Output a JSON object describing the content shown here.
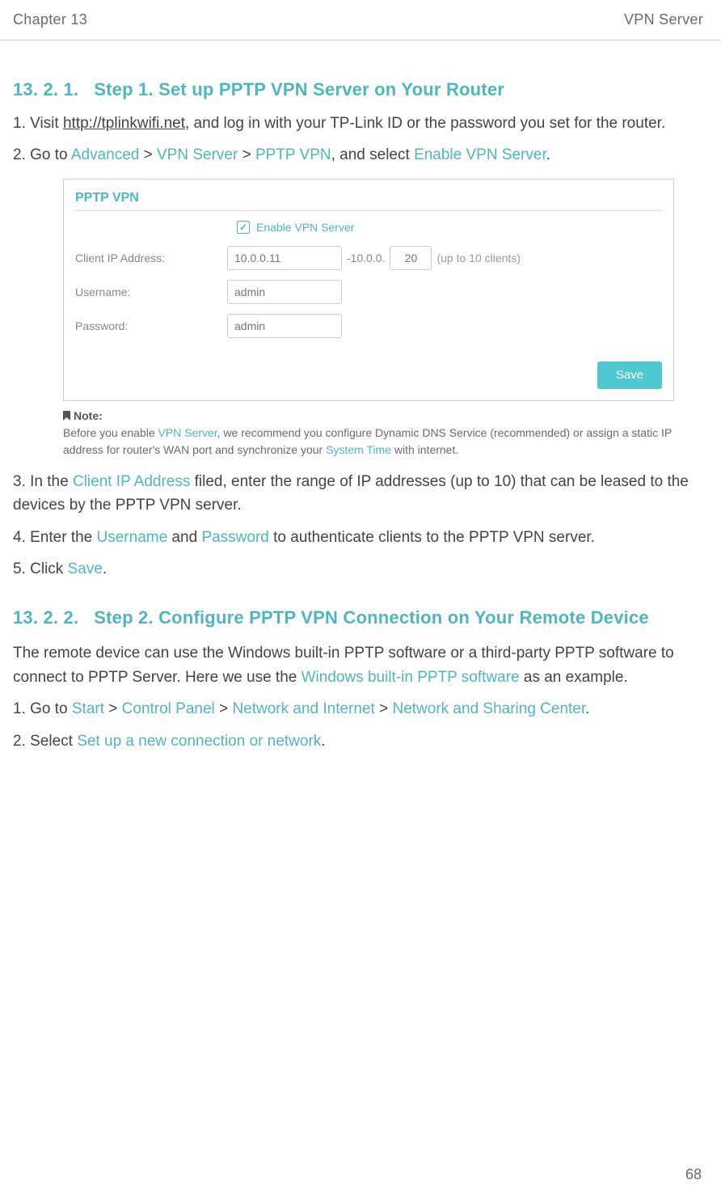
{
  "header": {
    "left": "Chapter 13",
    "right": "VPN Server"
  },
  "section1": {
    "number": "13. 2. 1.",
    "title": "Step 1. Set up PPTP VPN Server on Your Router"
  },
  "steps1": {
    "s1a": "1. Visit ",
    "s1link": "http://tplinkwifi.net",
    "s1b": ", and log in with your TP-Link ID or the password you set for the router.",
    "s2a": "2. Go to ",
    "s2t1": "Advanced",
    "s2t2": "VPN Server",
    "s2t3": "PPTP VPN",
    "s2b": ", and select ",
    "s2t4": "Enable VPN Server",
    "s2c": "."
  },
  "screenshot": {
    "title": "PPTP VPN",
    "enable_label": "Enable VPN Server",
    "row_client_label": "Client IP Address:",
    "client_ip_start": "10.0.0.11",
    "mid": "-10.0.0.",
    "client_ip_end": "20",
    "hint": "(up to 10 clients)",
    "row_user_label": "Username:",
    "username": "admin",
    "row_pass_label": "Password:",
    "password": "admin",
    "save": "Save"
  },
  "note": {
    "label": "Note:",
    "a": "Before you enable ",
    "t1": "VPN Server",
    "b": ", we recommend you configure Dynamic DNS Service (recommended) or assign a static IP address for router's WAN port and synchronize your ",
    "t2": "System Time",
    "c": " with internet."
  },
  "steps2": {
    "s3a": "3. In the ",
    "s3t": "Client IP Address",
    "s3b": " filed, enter the range of IP addresses (up to 10) that can be leased to the devices by the PPTP VPN server.",
    "s4a": "4. Enter the ",
    "s4t1": "Username",
    "s4m": " and ",
    "s4t2": "Password",
    "s4b": " to authenticate clients to the PPTP VPN server.",
    "s5a": "5. Click ",
    "s5t": "Save",
    "s5b": "."
  },
  "section2": {
    "number": "13. 2. 2.",
    "title": "Step 2. Configure PPTP VPN Connection on Your Remote Device"
  },
  "para2": {
    "a": "The remote device can use the Windows built-in PPTP software or a third-party PPTP software to connect to PPTP Server. Here we use the ",
    "t": "Windows built-in PPTP software",
    "b": " as an example."
  },
  "steps3": {
    "s1a": "1. Go to ",
    "t1": "Start",
    "t2": "Control Panel",
    "t3": "Network and Internet",
    "t4": "Network and Sharing Center",
    "s1b": ".",
    "s2a": "2. Select ",
    "t5": "Set up a new connection or network",
    "s2b": "."
  },
  "page_number": "68"
}
